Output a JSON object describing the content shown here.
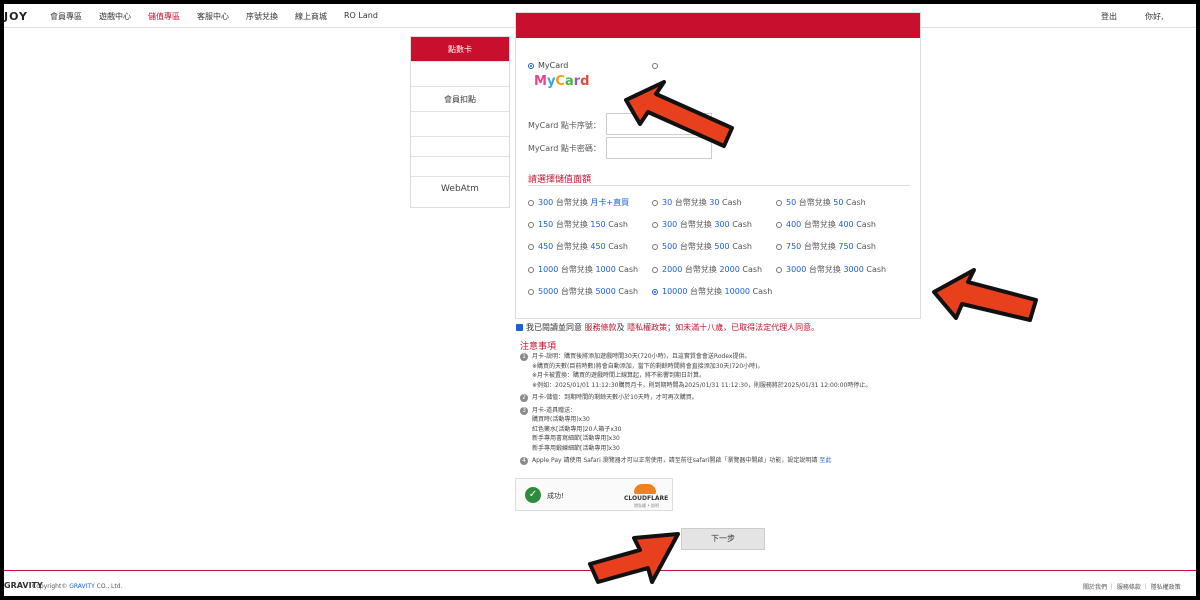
{
  "topnav": {
    "logo": "JOY",
    "items": [
      "會員專區",
      "遊戲中心",
      "儲值專區",
      "客服中心",
      "序號兌換",
      "線上商城",
      "RO Land"
    ],
    "active_index": 2,
    "logout": "登出",
    "greeting": "你好,"
  },
  "sidebar": {
    "items": [
      "點數卡",
      "",
      "會員扣點",
      "",
      "",
      "",
      "WebAtm"
    ]
  },
  "payment": {
    "method_mycard": "MyCard",
    "mycard_logo": "MyCard",
    "serial_label": "MyCard 點卡序號：",
    "password_label": "MyCard 點卡密碼：",
    "section_title": "請選擇儲值面額",
    "amounts": [
      {
        "twd": "300",
        "mid": " 台幣兌換 ",
        "cash": "月卡+直買",
        "suffix": "",
        "selected": false
      },
      {
        "twd": "30",
        "mid": " 台幣兌換 ",
        "cash": "30",
        "suffix": " Cash",
        "selected": false
      },
      {
        "twd": "50",
        "mid": " 台幣兌換 ",
        "cash": "50",
        "suffix": " Cash",
        "selected": false
      },
      {
        "twd": "150",
        "mid": " 台幣兌換 ",
        "cash": "150",
        "suffix": " Cash",
        "selected": false
      },
      {
        "twd": "300",
        "mid": " 台幣兌換 ",
        "cash": "300",
        "suffix": " Cash",
        "selected": false
      },
      {
        "twd": "400",
        "mid": " 台幣兌換 ",
        "cash": "400",
        "suffix": " Cash",
        "selected": false
      },
      {
        "twd": "450",
        "mid": " 台幣兌換 ",
        "cash": "450",
        "suffix": " Cash",
        "selected": false
      },
      {
        "twd": "500",
        "mid": " 台幣兌換 ",
        "cash": "500",
        "suffix": " Cash",
        "selected": false
      },
      {
        "twd": "750",
        "mid": " 台幣兌換 ",
        "cash": "750",
        "suffix": " Cash",
        "selected": false
      },
      {
        "twd": "1000",
        "mid": " 台幣兌換 ",
        "cash": "1000",
        "suffix": " Cash",
        "selected": false
      },
      {
        "twd": "2000",
        "mid": " 台幣兌換 ",
        "cash": "2000",
        "suffix": " Cash",
        "selected": false
      },
      {
        "twd": "3000",
        "mid": " 台幣兌換 ",
        "cash": "3000",
        "suffix": " Cash",
        "selected": false
      },
      {
        "twd": "5000",
        "mid": " 台幣兌換 ",
        "cash": "5000",
        "suffix": " Cash",
        "selected": false
      },
      {
        "twd": "10000",
        "mid": " 台幣兌換 ",
        "cash": "10000",
        "suffix": " Cash",
        "selected": true
      }
    ]
  },
  "agree": {
    "prefix": "我已閱讀並同意",
    "terms": "服務條款",
    "and": "及",
    "privacy": "隱私權政策",
    "suffix": "；如未滿十八歲，已取得法定代理人同意。"
  },
  "notes": {
    "title": "注意事項",
    "items": [
      {
        "num": "1",
        "lines": [
          "月卡-說明：購買後將添加遊戲時間30天(720小時)，且這實質會會送Rodex提供。",
          "※購買的天數(目前時數)將會自動添加，當下的剩餘時間將會直接添加30天(720小時)。",
          "※月卡被置換：購買的遊戲時間上線算起，將不影響到期日計算。",
          "※例如：2025/01/01 11:12:30購買月卡，則到期時間為2025/01/31 11:12:30，則服務將於2025/01/31 12:00:00時停止。"
        ]
      },
      {
        "num": "2",
        "lines": [
          "月卡-儲值：到期時間的剩餘天數小於10天時，才可再次購買。"
        ]
      },
      {
        "num": "3",
        "lines": [
          "月卡-道具贈送：",
          "購買時(活動專用)x30",
          "紅色藥水[活動專用]20人箱子x30",
          "新手專用書寫細節[活動專用]x30",
          "新手專用鍛練細節[活動專用]x30"
        ]
      },
      {
        "num": "4",
        "lines": [
          "Apple Pay 請使用 Safari 瀏覽器才可以正常使用，請至前往safari開啟「瀏覽器中開啟」功能，設定說明請 "
        ],
        "link": "至此"
      }
    ]
  },
  "cloudflare": {
    "status": "成功!",
    "brand": "CLOUDFLARE",
    "links": "隱私權 • 說明"
  },
  "next_button": "下一步",
  "footer": {
    "logo": "GRAVITY",
    "copy_prefix": "Copyright© ",
    "copy_brand": "GRAVITY",
    "copy_suffix": " CO., Ltd.",
    "links": "關於我們 ｜ 服務條款 ｜ 隱私權政策"
  },
  "colors": {
    "accent": "#c8102e",
    "link": "#1a5fd3",
    "arrow": "#e8401c"
  }
}
